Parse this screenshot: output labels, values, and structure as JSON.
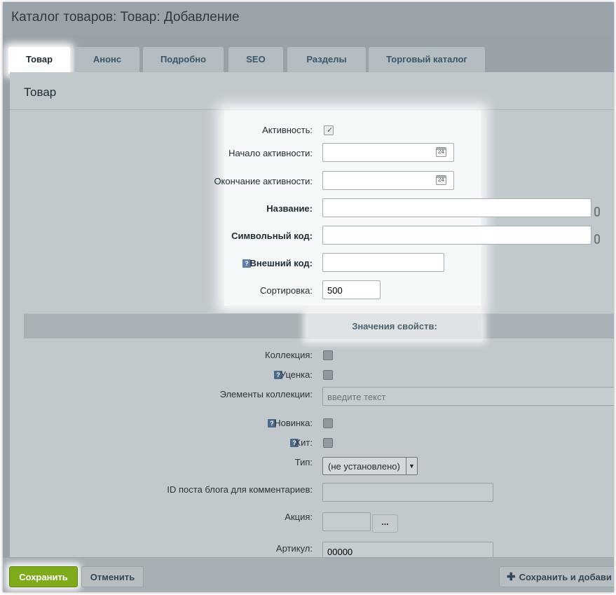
{
  "window": {
    "title": "Каталог товаров: Товар: Добавление"
  },
  "tabs": [
    {
      "label": "Товар",
      "active": true
    },
    {
      "label": "Анонс"
    },
    {
      "label": "Подробно"
    },
    {
      "label": "SEO"
    },
    {
      "label": "Разделы"
    },
    {
      "label": "Торговый каталог"
    }
  ],
  "section": {
    "title": "Товар"
  },
  "fields": {
    "active": {
      "label": "Активность:",
      "checked": true
    },
    "active_from": {
      "label": "Начало активности:",
      "value": "",
      "icon_text": "24"
    },
    "active_to": {
      "label": "Окончание активности:",
      "value": "",
      "icon_text": "24"
    },
    "name": {
      "label": "Название:",
      "value": ""
    },
    "code": {
      "label": "Символьный код:",
      "value": ""
    },
    "external_code": {
      "label": "Внешний код:",
      "value": "",
      "help": "?"
    },
    "sort": {
      "label": "Сортировка:",
      "value": "500"
    }
  },
  "properties": {
    "title": "Значения свойств:",
    "collection": {
      "label": "Коллекция:",
      "checked": false
    },
    "markdown": {
      "label": "Уценка:",
      "checked": false,
      "help": "?"
    },
    "collection_items": {
      "label": "Элементы коллекции:",
      "placeholder": "введите текст"
    },
    "novelty": {
      "label": "Новинка:",
      "checked": false,
      "help": "?"
    },
    "hit": {
      "label": "Хит:",
      "checked": false,
      "help": "?"
    },
    "type": {
      "label": "Тип:",
      "value": "(не установлено)"
    },
    "blog_post_id": {
      "label": "ID поста блога для комментариев:",
      "value": ""
    },
    "promo": {
      "label": "Акция:",
      "value": "",
      "button": "..."
    },
    "article": {
      "label": "Артикул:",
      "value": "00000"
    }
  },
  "footer": {
    "save": "Сохранить",
    "cancel": "Отменить",
    "save_and_add": "Сохранить и добави"
  },
  "colors": {
    "save_button": "#7eaa1c",
    "tab_active": "#ffffff",
    "tab_inactive": "#b3bcc1",
    "background": "#99a2a8"
  }
}
